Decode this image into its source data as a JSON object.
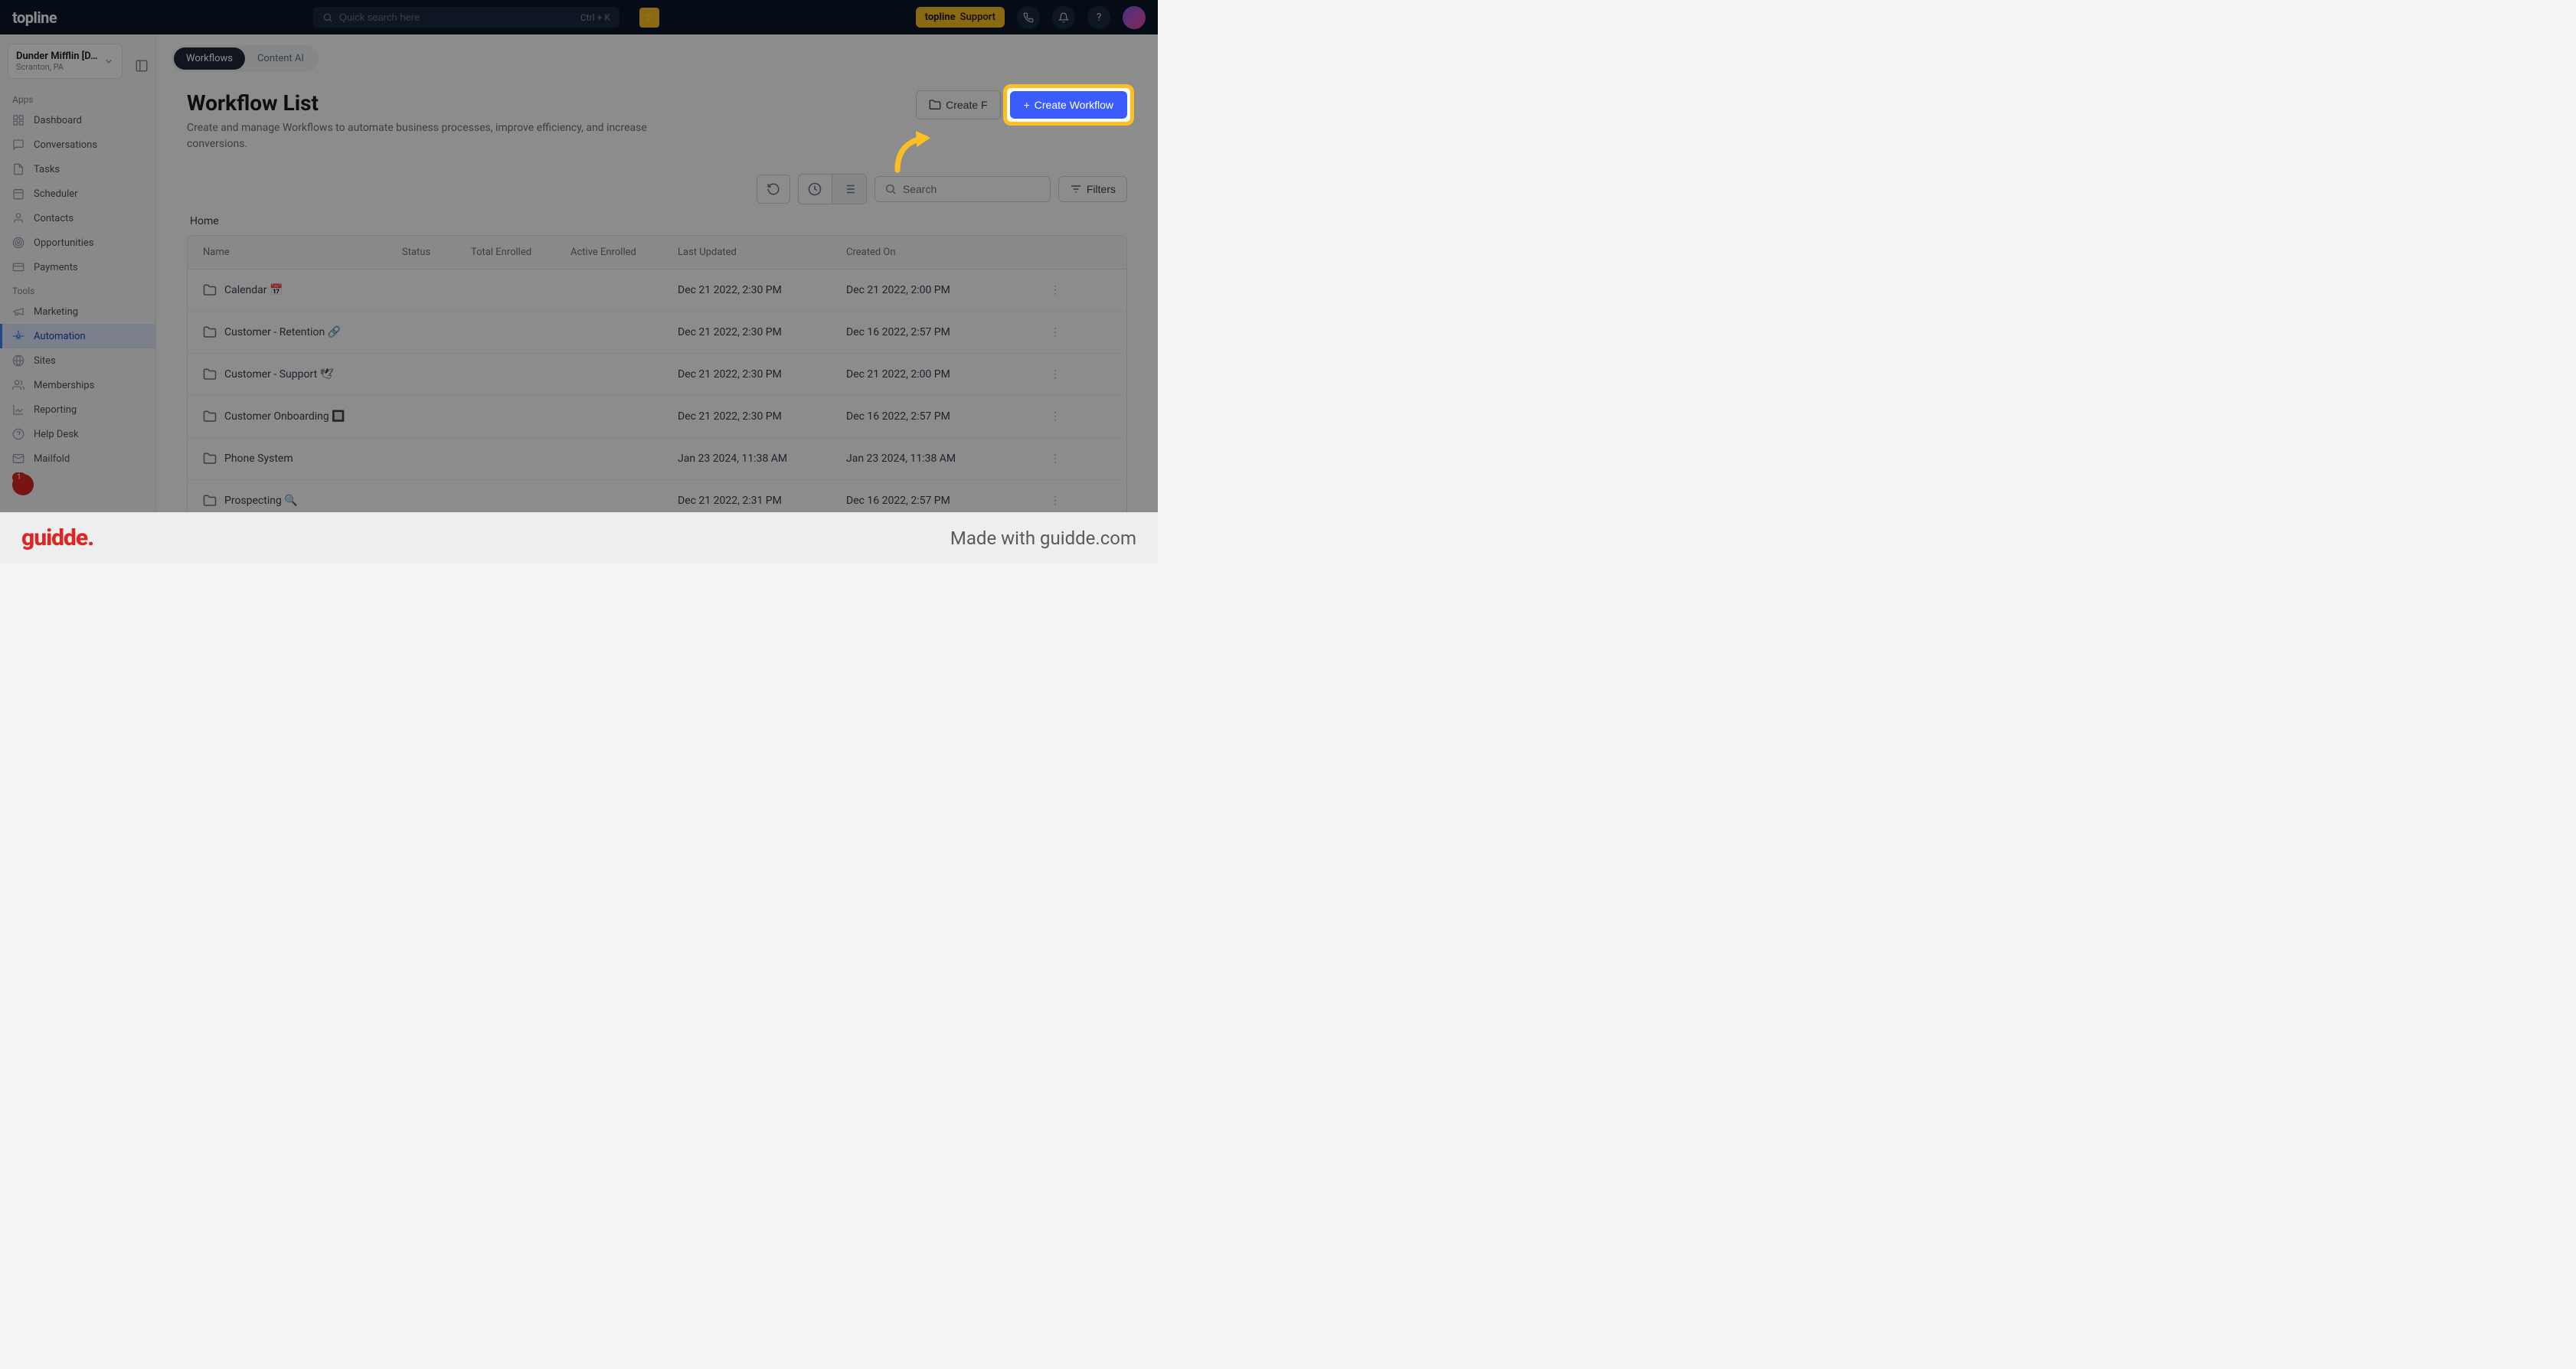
{
  "topbar": {
    "logo": "topline",
    "search_placeholder": "Quick search here",
    "kbd_hint": "Ctrl + K",
    "support_prefix": "topline",
    "support_label": "Support"
  },
  "org": {
    "name": "Dunder Mifflin [D…",
    "location": "Scranton, PA"
  },
  "sidebar": {
    "apps_header": "Apps",
    "tools_header": "Tools",
    "apps": [
      {
        "label": "Dashboard",
        "icon": "grid"
      },
      {
        "label": "Conversations",
        "icon": "chat"
      },
      {
        "label": "Tasks",
        "icon": "doc"
      },
      {
        "label": "Scheduler",
        "icon": "calendar"
      },
      {
        "label": "Contacts",
        "icon": "user"
      },
      {
        "label": "Opportunities",
        "icon": "target"
      },
      {
        "label": "Payments",
        "icon": "card"
      }
    ],
    "tools": [
      {
        "label": "Marketing",
        "icon": "megaphone"
      },
      {
        "label": "Automation",
        "icon": "gear",
        "active": true
      },
      {
        "label": "Sites",
        "icon": "globe"
      },
      {
        "label": "Memberships",
        "icon": "users"
      },
      {
        "label": "Reporting",
        "icon": "chart"
      },
      {
        "label": "Help Desk",
        "icon": "help"
      },
      {
        "label": "Mailfold",
        "icon": "mail"
      }
    ],
    "badge": "1"
  },
  "tabs": [
    {
      "label": "Workflows",
      "active": true
    },
    {
      "label": "Content AI",
      "active": false
    }
  ],
  "page": {
    "title": "Workflow List",
    "description": "Create and manage Workflows to automate business processes, improve efficiency, and increase conversions.",
    "create_folder": "Create F",
    "create_workflow": "Create Workflow",
    "breadcrumb": "Home",
    "search_placeholder": "Search",
    "filters_label": "Filters"
  },
  "table": {
    "headers": [
      "Name",
      "Status",
      "Total Enrolled",
      "Active Enrolled",
      "Last Updated",
      "Created On"
    ],
    "rows": [
      {
        "name": "Calendar 📅",
        "updated": "Dec 21 2022, 2:30 PM",
        "created": "Dec 21 2022, 2:00 PM"
      },
      {
        "name": "Customer - Retention 🔗",
        "updated": "Dec 21 2022, 2:30 PM",
        "created": "Dec 16 2022, 2:57 PM"
      },
      {
        "name": "Customer - Support 🕊",
        "updated": "Dec 21 2022, 2:30 PM",
        "created": "Dec 21 2022, 2:00 PM"
      },
      {
        "name": "Customer Onboarding 🔲",
        "updated": "Dec 21 2022, 2:30 PM",
        "created": "Dec 16 2022, 2:57 PM"
      },
      {
        "name": "Phone System",
        "updated": "Jan 23 2024, 11:38 AM",
        "created": "Jan 23 2024, 11:38 AM"
      },
      {
        "name": "Prospecting 🔍",
        "updated": "Dec 21 2022, 2:31 PM",
        "created": "Dec 16 2022, 2:57 PM"
      }
    ]
  },
  "footer": {
    "logo": "guidde.",
    "made_with": "Made with guidde.com"
  }
}
